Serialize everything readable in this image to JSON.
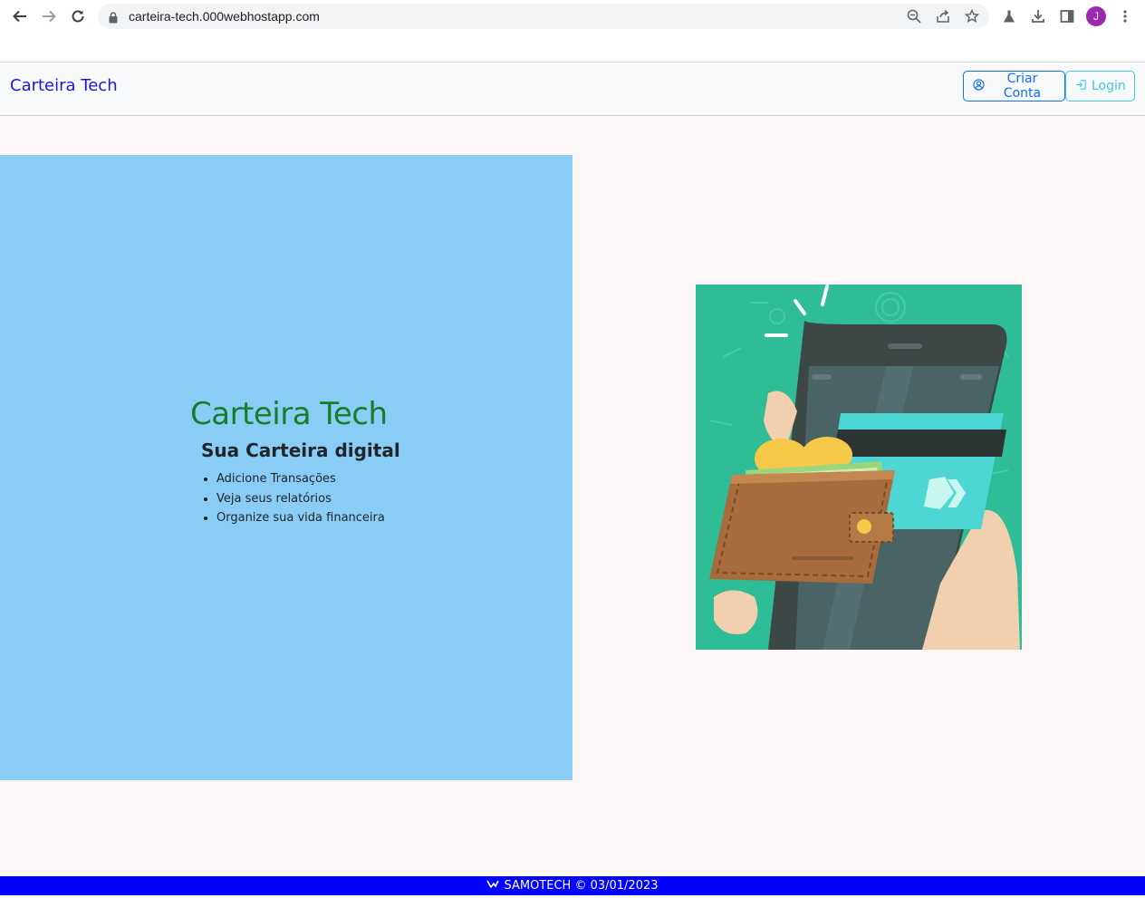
{
  "browser": {
    "url": "carteira-tech.000webhostapp.com",
    "avatar_letter": "J",
    "avatar_color": "#9c27b0"
  },
  "navbar": {
    "brand": "Carteira Tech",
    "criar_label": "Criar Conta",
    "login_label": "Login"
  },
  "hero": {
    "title": "Carteira Tech",
    "subtitle": "Sua Carteira digital",
    "features": [
      "Adicione Transações",
      "Veja seus relatórios",
      "Organize sua vida financeira"
    ]
  },
  "footer": {
    "text": "SAMOTECH © 03/01/2023"
  },
  "colors": {
    "brand": "#1a1ad6",
    "hero_bg": "#89cdf6",
    "hero_title": "#167d2a",
    "footer_bg": "#0000ff",
    "primary": "#0d6efd",
    "info": "#3dc8e8"
  },
  "icons": {
    "criar": "user-circle-icon",
    "login": "login-icon",
    "footer": "logo-icon"
  }
}
